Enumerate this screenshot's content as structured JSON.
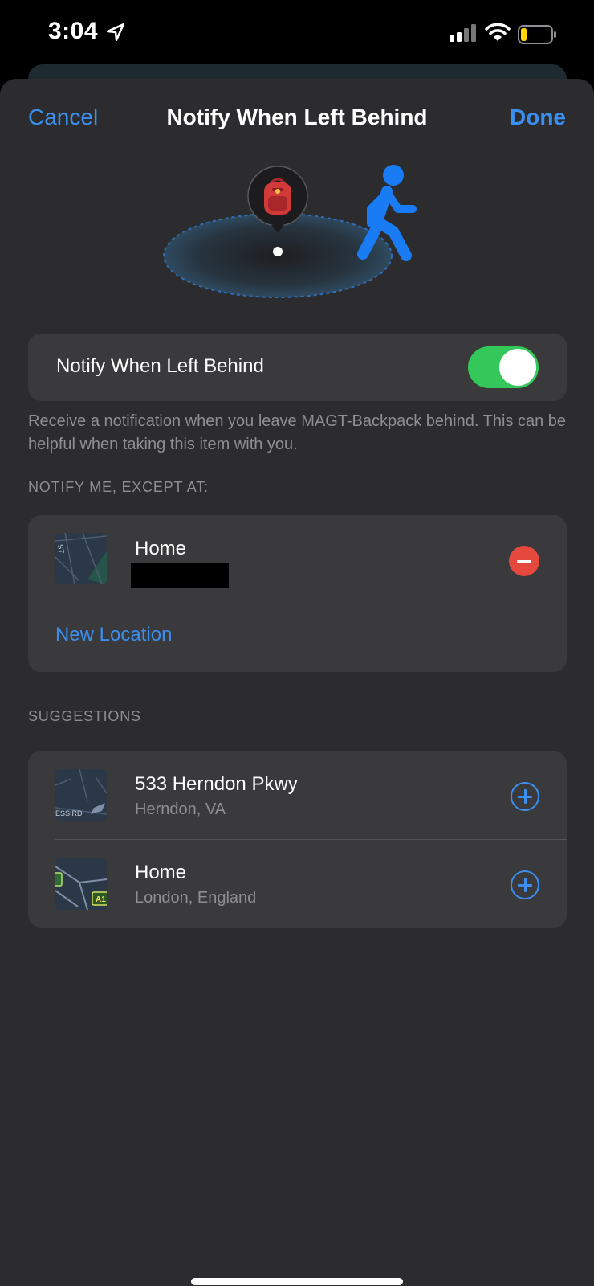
{
  "status_bar": {
    "time": "3:04",
    "icons": [
      "location-arrow-icon",
      "cellular-signal-icon",
      "wifi-icon",
      "battery-icon"
    ]
  },
  "nav": {
    "cancel": "Cancel",
    "title": "Notify When Left Behind",
    "done": "Done"
  },
  "illustration": {
    "item_icon": "backpack-icon",
    "person_icon": "walking-person-icon"
  },
  "toggle": {
    "label": "Notify When Left Behind",
    "on": true
  },
  "footnote": "Receive a notification when you leave MAGT-Backpack behind. This can be helpful when taking this item with you.",
  "except_section": {
    "header": "NOTIFY ME, EXCEPT AT:",
    "locations": [
      {
        "title": "Home"
      }
    ],
    "new_location": "New Location"
  },
  "suggestions_section": {
    "header": "SUGGESTIONS",
    "items": [
      {
        "title": "533 Herndon Pkwy",
        "subtitle": "Herndon, VA",
        "map_label": "ESSIRD"
      },
      {
        "title": "Home",
        "subtitle": "London, England",
        "map_label": "A1"
      }
    ]
  },
  "colors": {
    "accent": "#3a8ff0",
    "toggle_on": "#34c759",
    "destructive": "#e5483d",
    "sheet": "#2c2c2e",
    "cell": "#3a3a3c"
  }
}
